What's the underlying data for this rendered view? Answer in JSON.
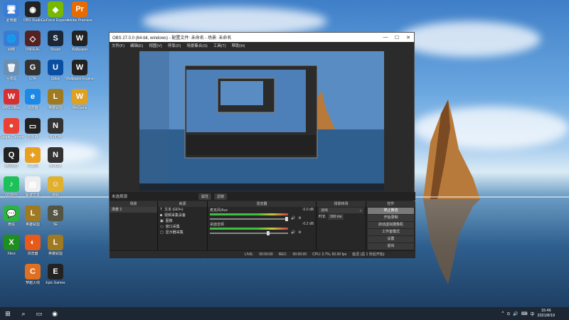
{
  "desktop": {
    "icons": [
      {
        "label": "此电脑",
        "glyph": "🖥",
        "color": "#3a7bd5"
      },
      {
        "label": "OBS Studio",
        "glyph": "◉",
        "color": "#222"
      },
      {
        "label": "GeForce Experience",
        "glyph": "◆",
        "color": "#76b900"
      },
      {
        "label": "Adobe Premiere",
        "glyph": "Pr",
        "color": "#e86b00"
      },
      {
        "label": "网络",
        "glyph": "🌐",
        "color": "#3a7bd5"
      },
      {
        "label": "UNREAL",
        "glyph": "◇",
        "color": "#552222"
      },
      {
        "label": "Steam",
        "glyph": "S",
        "color": "#1b2838"
      },
      {
        "label": "Wallpaper",
        "glyph": "W",
        "color": "#222"
      },
      {
        "label": "回收站",
        "glyph": "🗑",
        "color": "#6a8fb0"
      },
      {
        "label": "GTA",
        "glyph": "G",
        "color": "#333"
      },
      {
        "label": "Uplay",
        "glyph": "U",
        "color": "#0a4ea2"
      },
      {
        "label": "Wallpaper Engine",
        "glyph": "W",
        "color": "#222"
      },
      {
        "label": "WPS Office",
        "glyph": "W",
        "color": "#d73030"
      },
      {
        "label": "浏览器",
        "glyph": "e",
        "color": "#1e88e5"
      },
      {
        "label": "英雄联盟",
        "glyph": "L",
        "color": "#a07a20"
      },
      {
        "label": "Google Chrome",
        "glyph": "●",
        "color": "#e94235"
      },
      {
        "label": "显示器",
        "glyph": "▭",
        "color": "#222"
      },
      {
        "label": "NVIDIA",
        "glyph": "N",
        "color": "#333"
      },
      {
        "label": "腾讯QQ",
        "glyph": "Q",
        "color": "#222"
      },
      {
        "label": "小工具",
        "glyph": "✦",
        "color": "#e8a020"
      },
      {
        "label": "NVIDIA",
        "glyph": "N",
        "color": "#333"
      },
      {
        "label": "QQ音乐",
        "glyph": "♪",
        "color": "#1ec05a"
      },
      {
        "label": "新建文本",
        "glyph": "▤",
        "color": "#eee"
      },
      {
        "label": "游戏",
        "glyph": "☺",
        "color": "#e0b030"
      },
      {
        "label": "WeGame",
        "glyph": "W",
        "color": "#e0a020"
      },
      {
        "label": "英雄联盟",
        "glyph": "L",
        "color": "#a07a20"
      },
      {
        "label": "SE",
        "glyph": "S",
        "color": "#554"
      },
      {
        "label": "微信",
        "glyph": "💬",
        "color": "#2db341"
      },
      {
        "label": "浏览器",
        "glyph": "◐",
        "color": "#e85a1a"
      },
      {
        "label": "英雄联盟",
        "glyph": "L",
        "color": "#a07a20"
      },
      {
        "label": "Xbox",
        "glyph": "X",
        "color": "#1e8f1e"
      },
      {
        "label": "穿越火线",
        "glyph": "C",
        "color": "#e07020"
      },
      {
        "label": "Epic Games",
        "glyph": "E",
        "color": "#222"
      }
    ]
  },
  "obs": {
    "title": "OBS 27.0.0 (64-bit, windows) - 配置文件: 未命名 - 场景: 未命名",
    "window_buttons": [
      "—",
      "☐",
      "✕"
    ],
    "menu": [
      "文件(F)",
      "编辑(E)",
      "视图(V)",
      "停靠(D)",
      "场景集合(S)",
      "工具(T)",
      "帮助(H)"
    ],
    "preview_bar": {
      "label": "未选择源",
      "buttons": [
        "属性",
        "滤镜"
      ]
    },
    "scenes": {
      "header": "场景",
      "items": [
        "场景 2"
      ]
    },
    "sources": {
      "header": "来源",
      "items": [
        "文本 (GDI+)",
        "视频采集设备",
        "图像",
        "窗口采集",
        "显示器采集"
      ]
    },
    "mixer": {
      "header": "混音器",
      "tracks": [
        {
          "name": "麦克风/Aux",
          "db": "-0.0 dB"
        },
        {
          "name": "桌面音频",
          "db": "-0.2 dB"
        }
      ]
    },
    "transitions": {
      "header": "场景转场",
      "type": "淡出",
      "duration_label": "时长",
      "duration": "300 ms"
    },
    "controls": {
      "header": "控件",
      "buttons": [
        "停止推流",
        "开始录制",
        "启动虚拟摄像机",
        "工作室模式",
        "设置",
        "退出"
      ]
    },
    "status": {
      "live_label": "LIVE:",
      "live_time": "00:00:00",
      "rec_label": "REC:",
      "rec_time": "00:00:00",
      "cpu": "CPU: 2.7%, 60.00 fps",
      "delay": "延迟 (总 1 秒后开始)"
    }
  },
  "taskbar": {
    "start_glyph": "⊞",
    "icons": [
      "⌕",
      "▭",
      "◉"
    ],
    "tray": [
      "^",
      "⊙",
      "🔊",
      "⌨",
      "中"
    ],
    "time": "15:46",
    "date": "2021/8/19"
  }
}
